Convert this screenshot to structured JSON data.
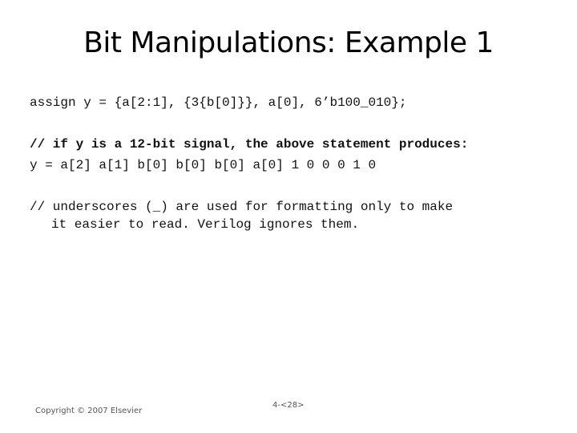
{
  "slide": {
    "title": "Bit Manipulations: Example 1",
    "code_lines": [
      "assign y = {a[2:1], {3{b[0]}}, a[0], 6’b100_010};",
      "// if y is a 12-bit signal, the above statement produces:",
      "y = a[2] a[1] b[0] b[0] b[0] a[0] 1 0 0 0 1 0",
      "// underscores (_) are used for formatting only to make",
      "it easier to read. Verilog ignores them."
    ],
    "footer": {
      "copyright": "Copyright © 2007 Elsevier",
      "page_number": "4-<28>"
    }
  }
}
